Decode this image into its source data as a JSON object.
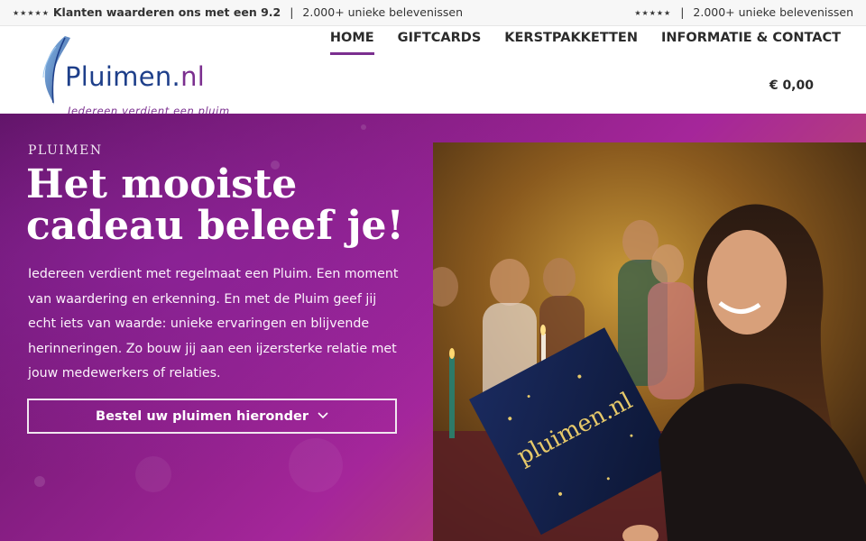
{
  "topbar": {
    "left_stars": "★★★★★",
    "left_rating": "Klanten waarderen ons met een 9.2",
    "left_sep": "|",
    "left_experiences": "2.000+ unieke belevenissen",
    "right_stars": "★★★★★",
    "right_sep": "|",
    "right_experiences": "2.000+ unieke belevenissen"
  },
  "logo": {
    "brand_main": "Pluimen.",
    "brand_tld": "nl",
    "tagline": "Iedereen verdient een pluim",
    "brand_color": "#1e3f8a",
    "accent_color": "#7b2f8f"
  },
  "nav": {
    "items": [
      {
        "label": "HOME",
        "active": true
      },
      {
        "label": "GIFTCARDS",
        "active": false
      },
      {
        "label": "KERSTPAKKETTEN",
        "active": false
      },
      {
        "label": "INFORMATIE & CONTACT",
        "active": false
      }
    ]
  },
  "cart": {
    "total": "€ 0,00"
  },
  "hero": {
    "eyebrow": "PLUIMEN",
    "title": "Het mooiste cadeau beleef je!",
    "body": "Iedereen verdient met regelmaat een Pluim. Een moment van waardering en erkenning. En met de Pluim geef jij echt iets van waarde: unieke ervaringen en blijvende herinneringen. Zo bouw jij aan een ijzersterke relatie met jouw medewerkers of relaties.",
    "cta_label": "Bestel uw pluimen hieronder",
    "cta_icon": "chevron-down-icon",
    "box_text": "pluimen.nl"
  },
  "colors": {
    "hero_purple": "#8a1f86",
    "hero_orange": "#d5704c",
    "nav_underline": "#7b2f8f"
  }
}
